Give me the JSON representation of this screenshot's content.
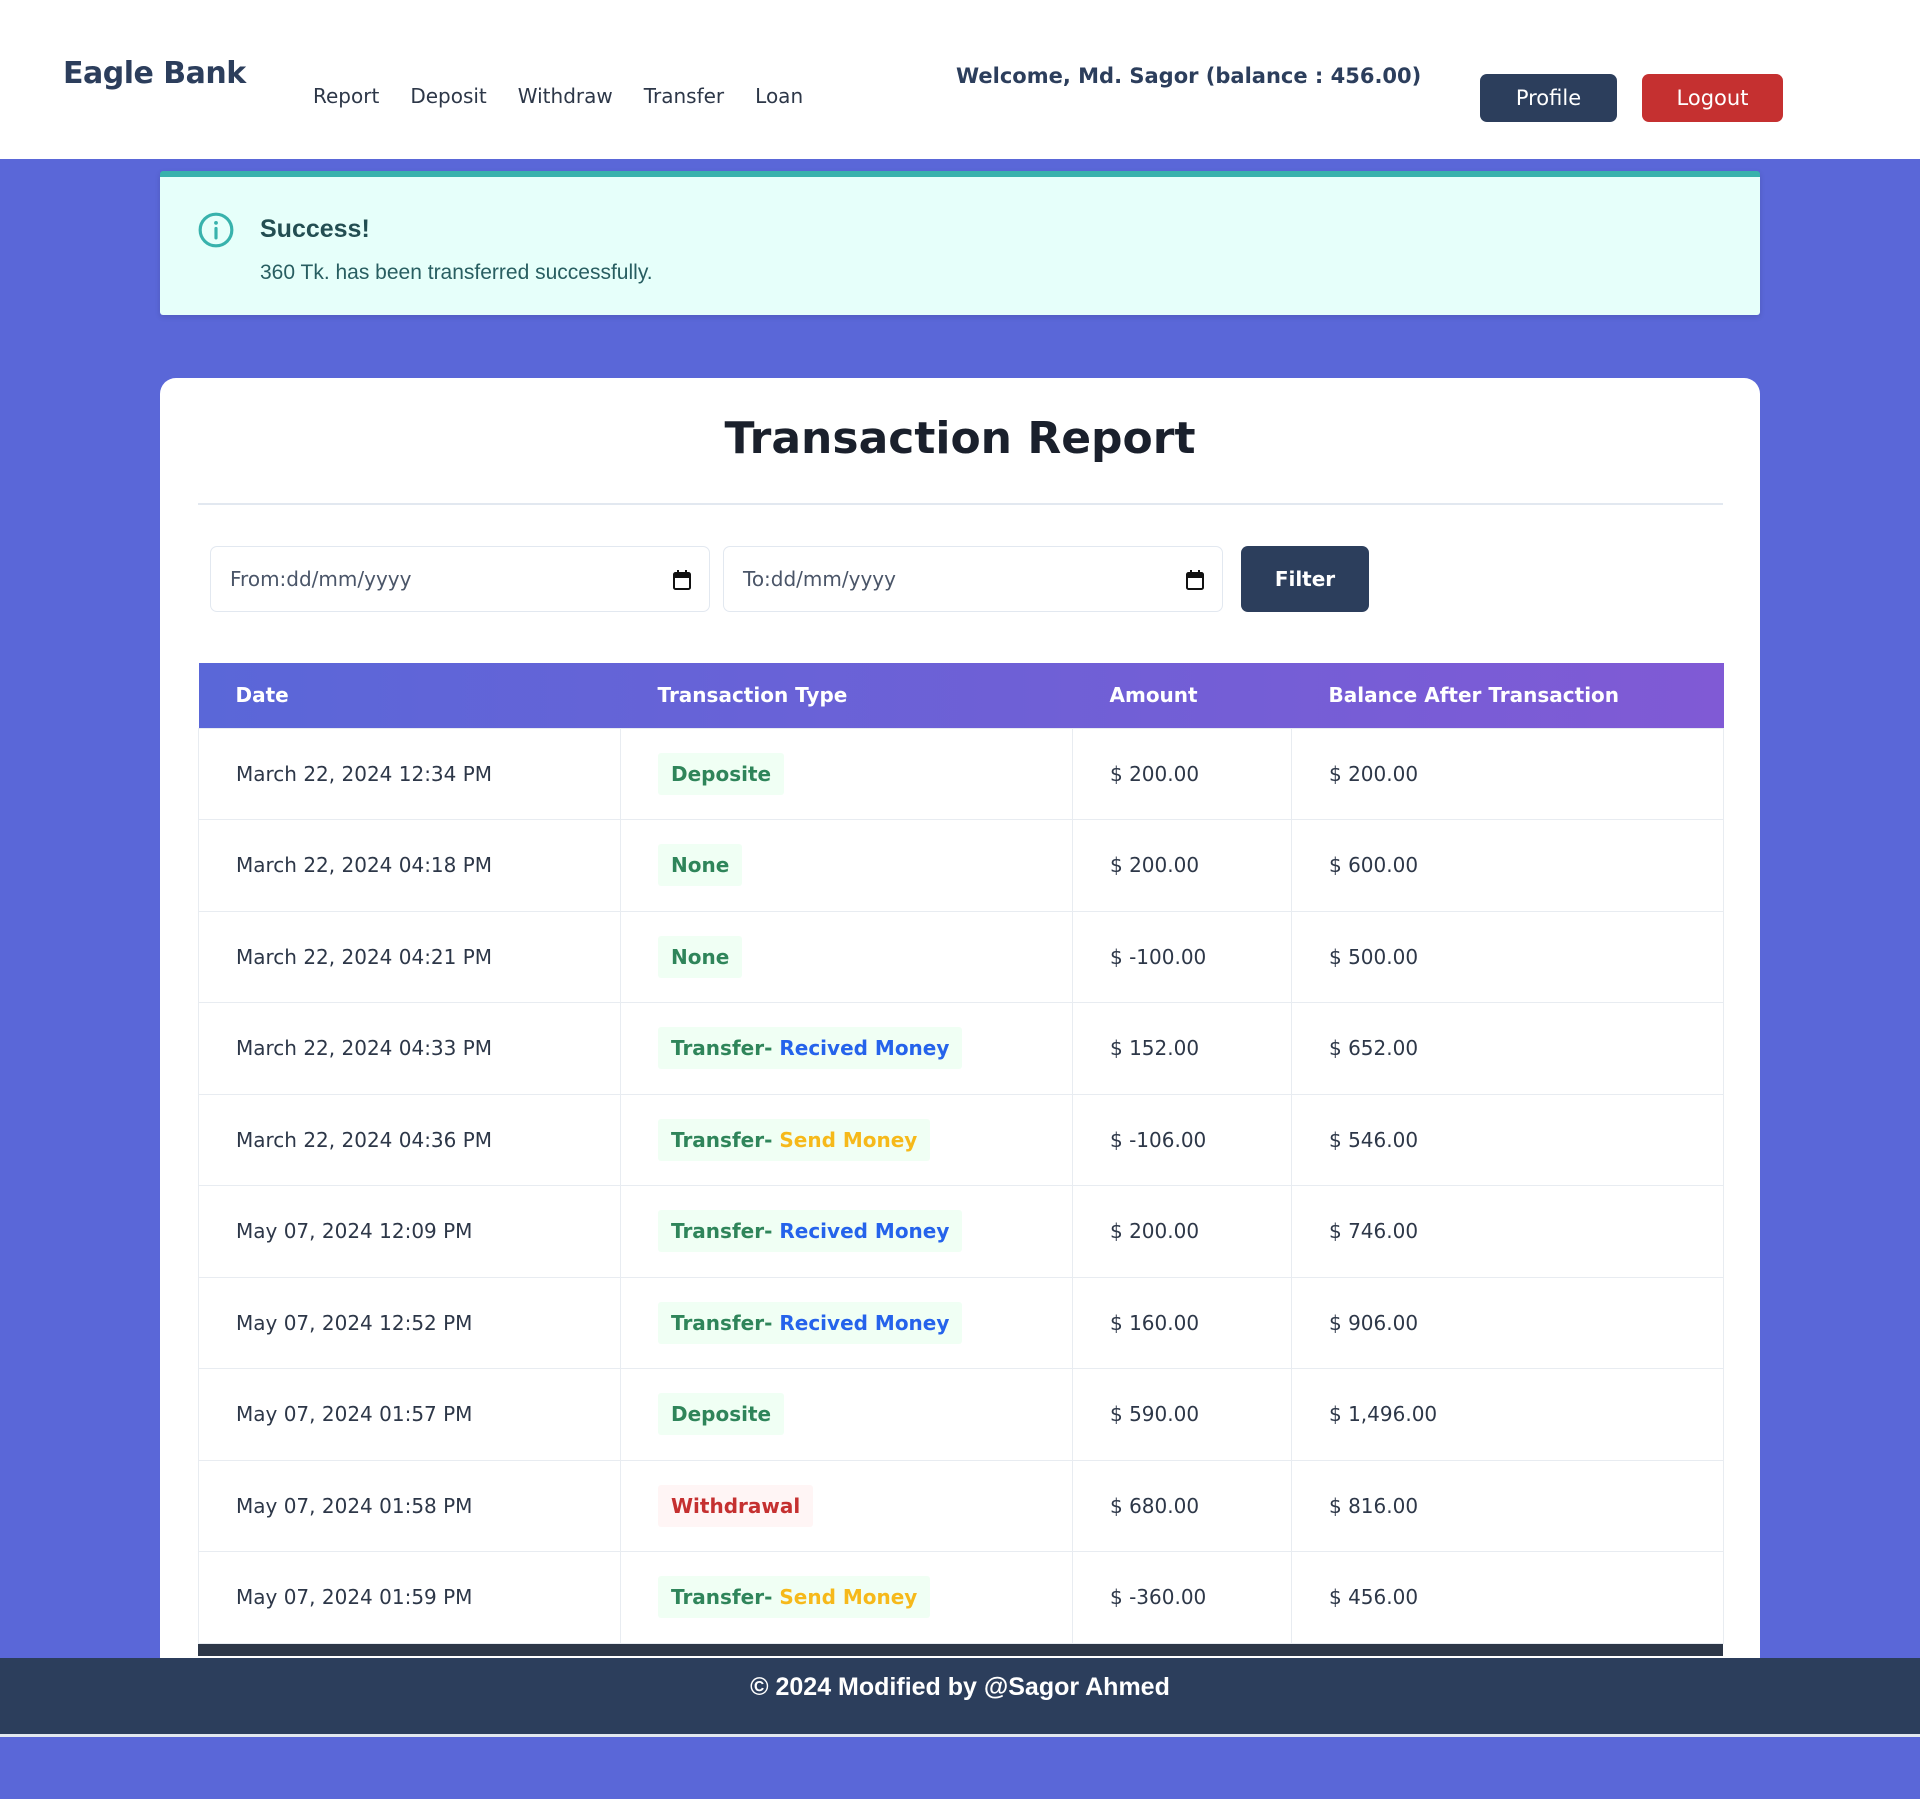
{
  "brand": "Eagle Bank",
  "nav": [
    "Report",
    "Deposit",
    "Withdraw",
    "Transfer",
    "Loan"
  ],
  "welcome": "Welcome, Md. Sagor (balance : 456.00)",
  "buttons": {
    "profile": "Profile",
    "logout": "Logout",
    "filter": "Filter"
  },
  "alert": {
    "title": "Success!",
    "message": "360 Tk. has been transferred successfully.",
    "icon": "info-icon"
  },
  "report": {
    "title": "Transaction Report",
    "from_placeholder": "From:dd/mm/yyyy",
    "to_placeholder": "To:dd/mm/yyyy",
    "columns": [
      "Date",
      "Transaction Type",
      "Amount",
      "Balance After Transaction"
    ],
    "rows": [
      {
        "date": "March 22, 2024 12:34 PM",
        "type": "Deposite",
        "suffix": "",
        "amount": "$ 200.00",
        "balance": "$ 200.00"
      },
      {
        "date": "March 22, 2024 04:18 PM",
        "type": "None",
        "suffix": "",
        "amount": "$ 200.00",
        "balance": "$ 600.00"
      },
      {
        "date": "March 22, 2024 04:21 PM",
        "type": "None",
        "suffix": "",
        "amount": "$ -100.00",
        "balance": "$ 500.00"
      },
      {
        "date": "March 22, 2024 04:33 PM",
        "type": "Transfer-",
        "suffix": "Recived Money",
        "amount": "$ 152.00",
        "balance": "$ 652.00"
      },
      {
        "date": "March 22, 2024 04:36 PM",
        "type": "Transfer-",
        "suffix": "Send Money",
        "amount": "$ -106.00",
        "balance": "$ 546.00"
      },
      {
        "date": "May 07, 2024 12:09 PM",
        "type": "Transfer-",
        "suffix": "Recived Money",
        "amount": "$ 200.00",
        "balance": "$ 746.00"
      },
      {
        "date": "May 07, 2024 12:52 PM",
        "type": "Transfer-",
        "suffix": "Recived Money",
        "amount": "$ 160.00",
        "balance": "$ 906.00"
      },
      {
        "date": "May 07, 2024 01:57 PM",
        "type": "Deposite",
        "suffix": "",
        "amount": "$ 590.00",
        "balance": "$ 1,496.00"
      },
      {
        "date": "May 07, 2024 01:58 PM",
        "type": "Withdrawal",
        "suffix": "",
        "amount": "$ 680.00",
        "balance": "$ 816.00"
      },
      {
        "date": "May 07, 2024 01:59 PM",
        "type": "Transfer-",
        "suffix": "Send Money",
        "amount": "$ -360.00",
        "balance": "$ 456.00"
      }
    ]
  },
  "footer": "© 2024 Modified by @Sagor Ahmed",
  "colors": {
    "background": "#5a67d8",
    "primary": "#2c3e5c",
    "danger": "#c53030",
    "alert_accent": "#38b2ac"
  }
}
